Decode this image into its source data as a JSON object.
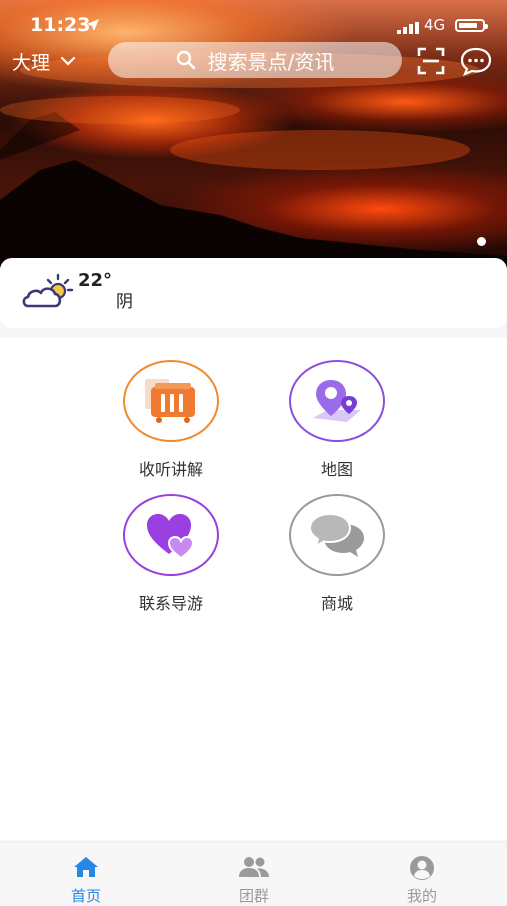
{
  "status": {
    "time": "11:23",
    "network": "4G"
  },
  "header": {
    "city": "大理",
    "search_placeholder": "搜索景点/资讯"
  },
  "weather": {
    "temperature": "22°",
    "condition": "阴"
  },
  "menu": [
    {
      "label": "收听讲解",
      "icon": "audio-guide-icon",
      "color": "#f08a2c"
    },
    {
      "label": "地图",
      "icon": "map-pin-icon",
      "color": "#8a4fe0"
    },
    {
      "label": "联系导游",
      "icon": "heart-icon",
      "color": "#9a3fe0"
    },
    {
      "label": "商城",
      "icon": "chat-bubbles-icon",
      "color": "#9a9a9a"
    }
  ],
  "tabbar": {
    "tabs": [
      {
        "label": "首页",
        "icon": "home-icon",
        "active": true
      },
      {
        "label": "团群",
        "icon": "group-icon",
        "active": false
      },
      {
        "label": "我的",
        "icon": "profile-icon",
        "active": false
      }
    ],
    "active_color": "#2a86e6"
  }
}
